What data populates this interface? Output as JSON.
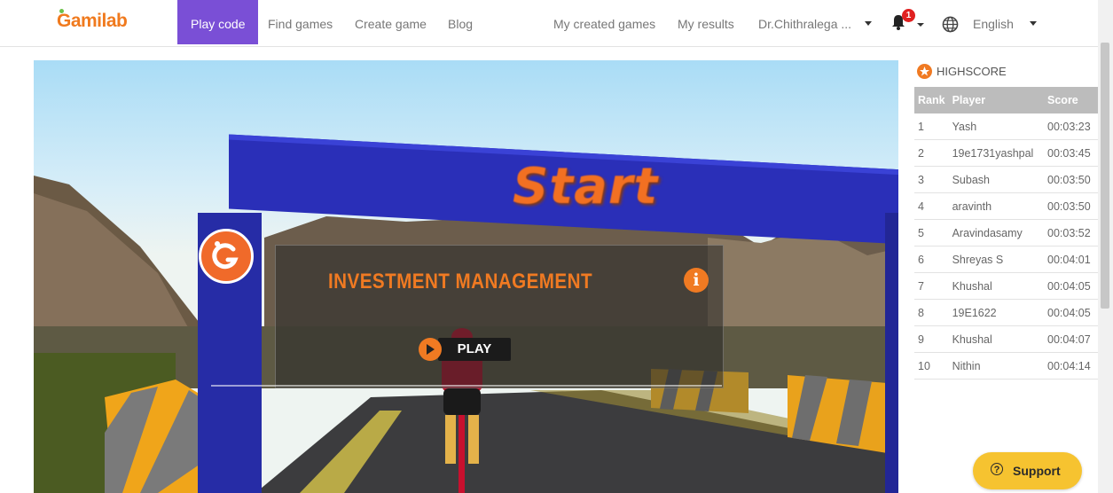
{
  "nav": {
    "logo": "Gamilab",
    "links": [
      "Play code",
      "Find games",
      "Create game",
      "Blog"
    ],
    "right_links": [
      "My created games",
      "My results"
    ],
    "user": "Dr.Chithralega ...",
    "notifications_count": "1",
    "language": "English"
  },
  "game": {
    "start_text": "Start",
    "title": "INVESTMENT MANAGEMENT",
    "play_label": "PLAY",
    "info": "i"
  },
  "highscore": {
    "title": "HIGHSCORE",
    "columns": [
      "Rank",
      "Player",
      "Score"
    ],
    "rows": [
      {
        "rank": "1",
        "player": "Yash",
        "score": "00:03:23"
      },
      {
        "rank": "2",
        "player": "19e1731yashpal",
        "score": "00:03:45"
      },
      {
        "rank": "3",
        "player": "Subash",
        "score": "00:03:50"
      },
      {
        "rank": "4",
        "player": "aravinth",
        "score": "00:03:50"
      },
      {
        "rank": "5",
        "player": "Aravindasamy",
        "score": "00:03:52"
      },
      {
        "rank": "6",
        "player": "Shreyas S",
        "score": "00:04:01"
      },
      {
        "rank": "7",
        "player": "Khushal",
        "score": "00:04:05"
      },
      {
        "rank": "8",
        "player": "19E1622",
        "score": "00:04:05"
      },
      {
        "rank": "9",
        "player": "Khushal",
        "score": "00:04:07"
      },
      {
        "rank": "10",
        "player": "Nithin",
        "score": "00:04:14"
      }
    ]
  },
  "support": {
    "label": "Support"
  },
  "colors": {
    "accent": "#7a4fd6",
    "brand_orange": "#f07a22",
    "support_yellow": "#f6c330"
  }
}
